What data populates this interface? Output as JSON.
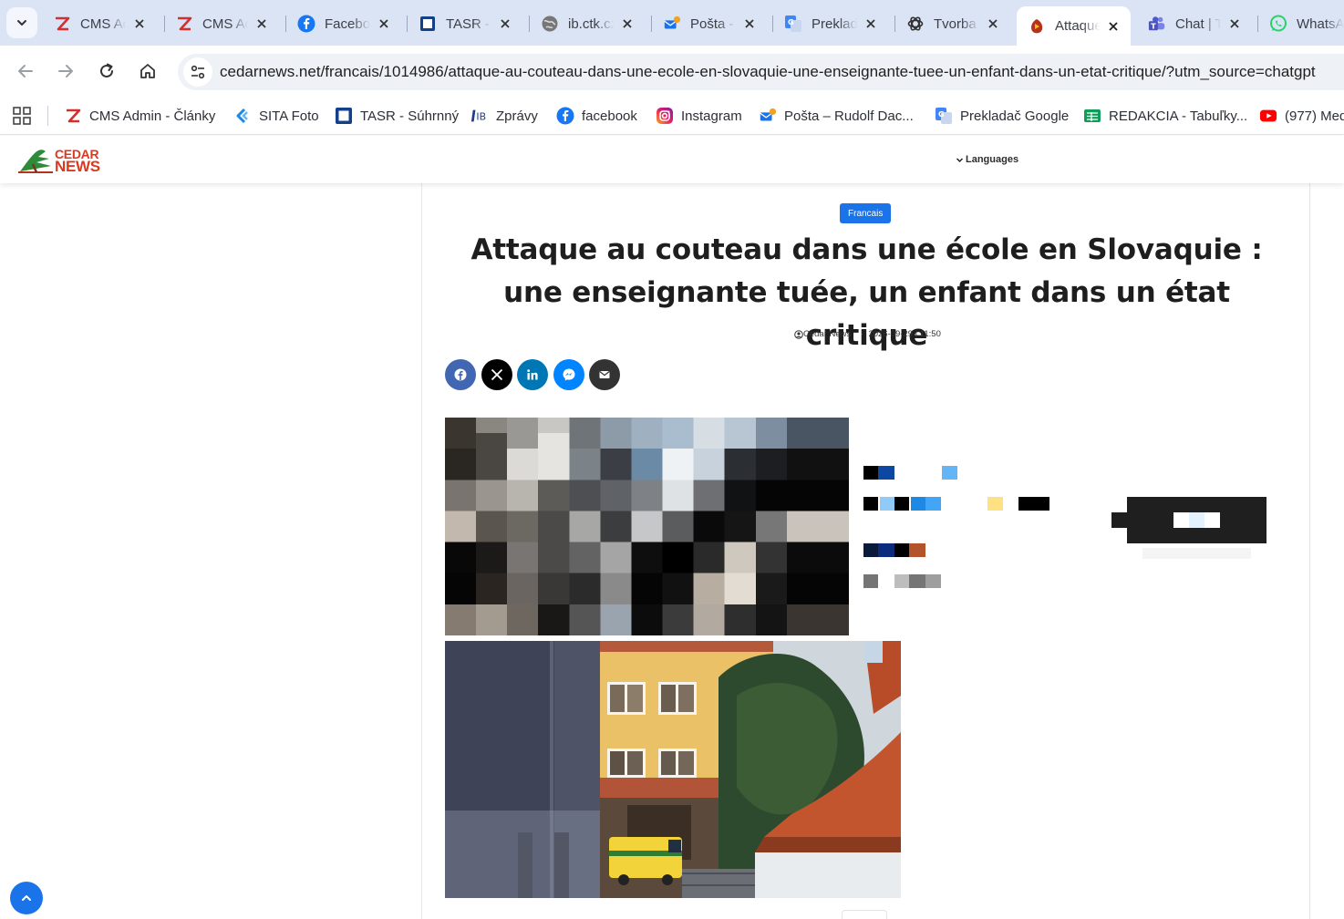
{
  "tabs": [
    {
      "title": "CMS Admin",
      "icon": "zeta-icon"
    },
    {
      "title": "CMS Admin",
      "icon": "zeta-icon"
    },
    {
      "title": "Facebook",
      "icon": "facebook-icon"
    },
    {
      "title": "TASR - Súhrnný",
      "icon": "tasr-icon"
    },
    {
      "title": "ib.ctk.cz",
      "icon": "globe-icon"
    },
    {
      "title": "Pošta - Rudolf",
      "icon": "mail-icon"
    },
    {
      "title": "Prekladač Google",
      "icon": "translate-icon"
    },
    {
      "title": "Tvorba",
      "icon": "openai-icon"
    },
    {
      "title": "Attaque au couteau",
      "icon": "cedar-icon",
      "active": true
    },
    {
      "title": "Chat | Teams",
      "icon": "teams-icon"
    },
    {
      "title": "WhatsApp",
      "icon": "whatsapp-icon"
    }
  ],
  "toolbar": {
    "url": "cedarnews.net/francais/1014986/attaque-au-couteau-dans-une-ecole-en-slovaquie-une-enseignante-tuee-un-enfant-dans-un-etat-critique/?utm_source=chatgpt"
  },
  "bookmarks": [
    {
      "label": "CMS Admin - Články",
      "icon": "zeta-icon"
    },
    {
      "label": "SITA Foto",
      "icon": "sita-icon"
    },
    {
      "label": "TASR - Súhrnný",
      "icon": "tasr-icon"
    },
    {
      "label": "Zprávy",
      "icon": "ib-icon"
    },
    {
      "label": "facebook",
      "icon": "facebook-icon"
    },
    {
      "label": "Instagram",
      "icon": "instagram-icon"
    },
    {
      "label": "Pošta – Rudolf Dac...",
      "icon": "mail-icon"
    },
    {
      "label": "Prekladač Google",
      "icon": "translate-icon"
    },
    {
      "label": "REDAKCIA - Tabuľky...",
      "icon": "sheets-icon"
    },
    {
      "label": "(977) Med",
      "icon": "youtube-icon"
    }
  ],
  "site": {
    "logo_text_1": "CEDAR",
    "logo_text_2": "NEWS",
    "languages_label": "Languages"
  },
  "article": {
    "category": "Francais",
    "title": "Attaque au couteau dans une école en Slovaquie : une enseignante tuée, un enfant dans un état critique",
    "author": "Cedar News",
    "date": "2026-09-29 | 11:50"
  },
  "colors": {
    "accent": "#1a73e8",
    "facebook": "#4267b2",
    "linkedin": "#0077b5",
    "messenger": "#0084ff",
    "x": "#000000",
    "email": "#333333"
  }
}
